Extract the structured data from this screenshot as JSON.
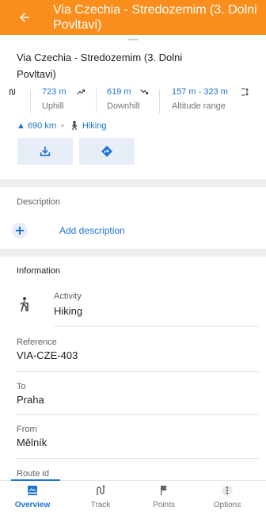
{
  "app_bar": {
    "title": "Via Czechia - Stredozemim (3. Dolni Povltavi)"
  },
  "route": {
    "name": "Via Czechia - Stredozemim (3. Dolni Povltavi)"
  },
  "stats": {
    "uphill": {
      "value": "723 m",
      "label": "Uphill"
    },
    "downhill": {
      "value": "619 m",
      "label": "Downhill"
    },
    "altitude": {
      "value": "157 m - 323 m",
      "label": "Altitude range"
    }
  },
  "meta": {
    "distance": "▲ 690 km",
    "separator": "•",
    "activity": "Hiking"
  },
  "description": {
    "section_label": "Description",
    "add_label": "Add description"
  },
  "information": {
    "section_label": "Information",
    "rows": [
      {
        "label": "Activity",
        "value": "Hiking"
      },
      {
        "label": "Reference",
        "value": "VIA-CZE-403"
      },
      {
        "label": "To",
        "value": "Praha"
      },
      {
        "label": "From",
        "value": "Mělník"
      },
      {
        "label": "Route id",
        "value": ""
      }
    ]
  },
  "bottom_nav": {
    "items": [
      {
        "label": "Overview",
        "active": true
      },
      {
        "label": "Track",
        "active": false
      },
      {
        "label": "Points",
        "active": false
      },
      {
        "label": "Options",
        "active": false
      }
    ]
  },
  "colors": {
    "app_bar": "#f98e1d",
    "accent": "#1e74d1",
    "button_bg": "#e7eef8",
    "section_gap": "#eeeeee"
  },
  "icons": {
    "back": "arrow-left-icon",
    "total": "route-icon",
    "uphill": "trend-up-icon",
    "downhill": "trend-down-icon",
    "altitude": "altitude-range-icon",
    "hiking": "hiker-icon",
    "download": "download-icon",
    "directions": "directions-icon",
    "add": "plus-circle-icon",
    "overview": "overview-icon",
    "track": "track-icon",
    "points": "flag-icon",
    "options": "more-vert-icon"
  }
}
